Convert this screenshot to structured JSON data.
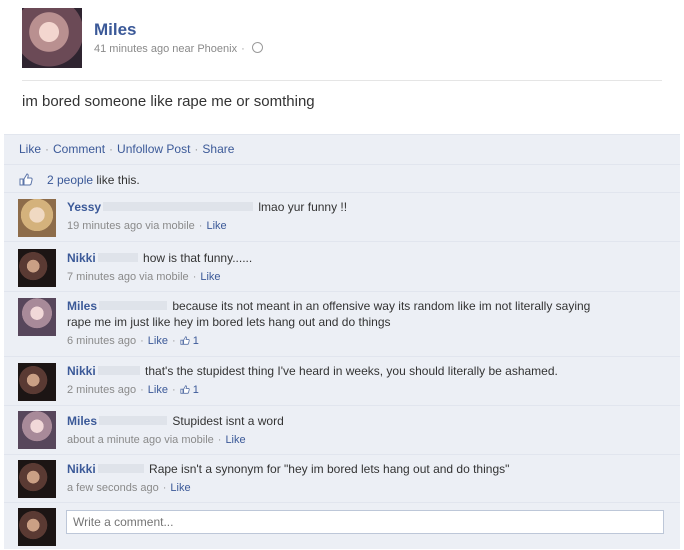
{
  "post": {
    "author": "Miles",
    "meta": "41 minutes ago near Phoenix",
    "text": "im bored someone like rape me or somthing"
  },
  "actions": {
    "like": "Like",
    "comment": "Comment",
    "unfollow": "Unfollow Post",
    "share": "Share"
  },
  "likes": {
    "count_link": "2 people",
    "suffix": "like this."
  },
  "comments": [
    {
      "name": "Yessy",
      "text": "lmao yur funny !!",
      "meta": "19 minutes ago via mobile",
      "like": "Like",
      "likes": ""
    },
    {
      "name": "Nikki",
      "text": "how is that funny......",
      "meta": "7 minutes ago via mobile",
      "like": "Like",
      "likes": ""
    },
    {
      "name": "Miles",
      "text": "because its not meant in an offensive way its random like im not literally saying",
      "text2": "rape me im just like hey im bored lets hang out and do things",
      "meta": "6 minutes ago",
      "like": "Like",
      "likes": "1"
    },
    {
      "name": "Nikki",
      "text": "that's the stupidest thing I've heard in weeks, you should literally be ashamed.",
      "meta": "2 minutes ago",
      "like": "Like",
      "likes": "1"
    },
    {
      "name": "Miles",
      "text": "Stupidest isnt a word",
      "meta": "about a minute ago via mobile",
      "like": "Like",
      "likes": ""
    },
    {
      "name": "Nikki",
      "text": "Rape isn't a synonym for \"hey im bored lets hang out and do things\"",
      "meta": "a few seconds ago",
      "like": "Like",
      "likes": ""
    }
  ],
  "composer": {
    "placeholder": "Write a comment..."
  },
  "icons": {
    "privacy": "globe-icon",
    "like": "thumbs-up-icon"
  },
  "colors": {
    "link": "#3b5998",
    "ufi_background": "#eceff5"
  }
}
